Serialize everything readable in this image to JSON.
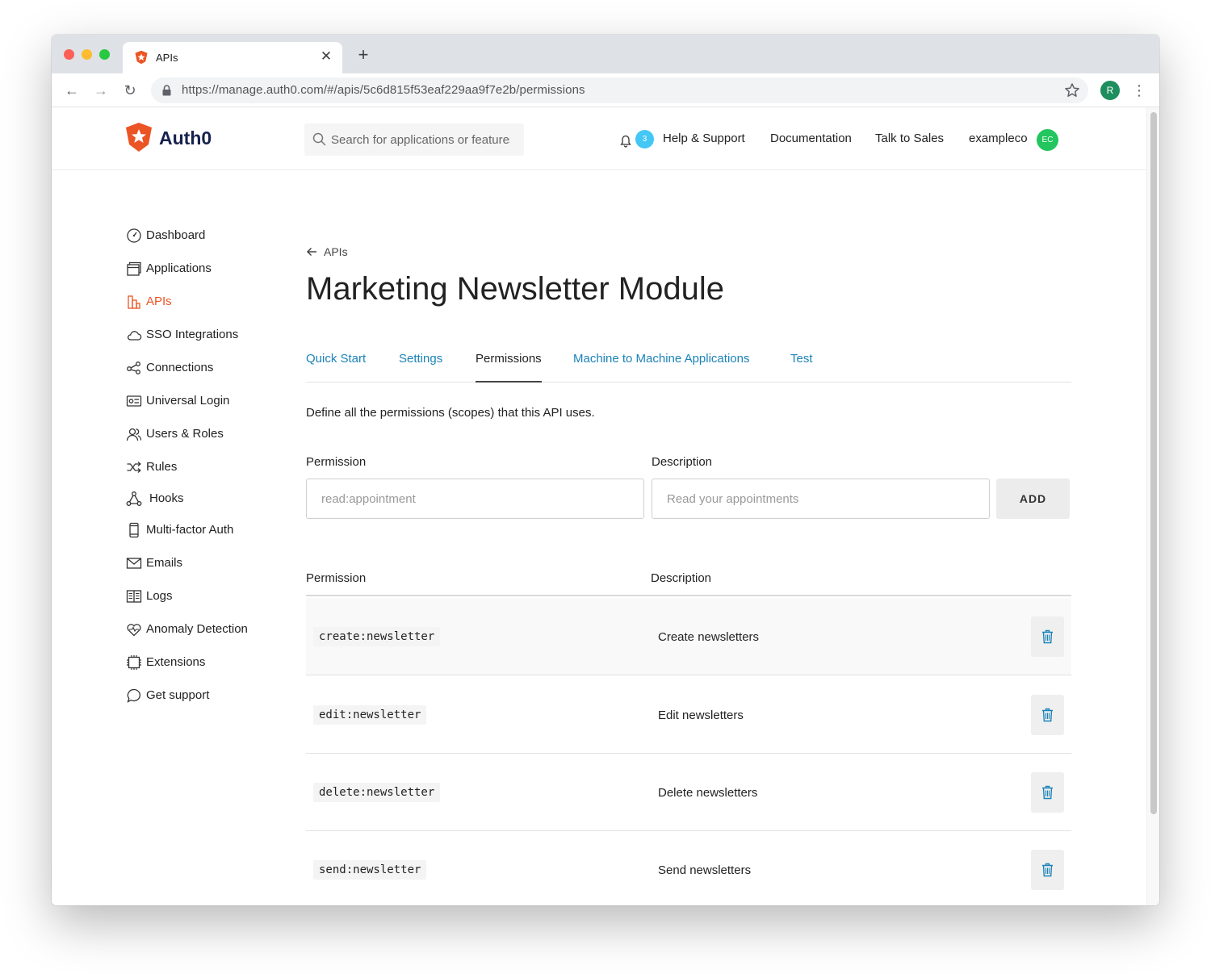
{
  "browser": {
    "tab_title": "APIs",
    "url": "https://manage.auth0.com/#/apis/5c6d815f53eaf229aa9f7e2b/permissions",
    "profile_initial": "R"
  },
  "header": {
    "logo_text": "Auth0",
    "search_placeholder": "Search for applications or features",
    "notification_count": "3",
    "links": [
      "Help & Support",
      "Documentation",
      "Talk to Sales"
    ],
    "tenant_name": "exampleco",
    "tenant_initials": "EC"
  },
  "sidebar": {
    "items": [
      {
        "label": "Dashboard",
        "icon": "gauge-icon"
      },
      {
        "label": "Applications",
        "icon": "applications-icon"
      },
      {
        "label": "APIs",
        "icon": "api-icon",
        "active": true
      },
      {
        "label": "SSO Integrations",
        "icon": "cloud-icon"
      },
      {
        "label": "Connections",
        "icon": "connections-icon"
      },
      {
        "label": "Universal Login",
        "icon": "login-icon"
      },
      {
        "label": "Users & Roles",
        "icon": "users-icon"
      },
      {
        "label": "Rules",
        "icon": "shuffle-icon"
      },
      {
        "label": "Hooks",
        "icon": "hooks-icon"
      },
      {
        "label": "Multi-factor Auth",
        "icon": "phone-icon"
      },
      {
        "label": "Emails",
        "icon": "mail-icon"
      },
      {
        "label": "Logs",
        "icon": "book-icon"
      },
      {
        "label": "Anomaly Detection",
        "icon": "heart-pulse-icon"
      },
      {
        "label": "Extensions",
        "icon": "chip-icon"
      },
      {
        "label": "Get support",
        "icon": "chat-bubble-icon"
      }
    ]
  },
  "main": {
    "back_label": "APIs",
    "title": "Marketing Newsletter Module",
    "tabs": [
      {
        "label": "Quick Start"
      },
      {
        "label": "Settings"
      },
      {
        "label": "Permissions",
        "active": true
      },
      {
        "label": "Machine to Machine Applications"
      },
      {
        "label": "Test"
      }
    ],
    "intro": "Define all the permissions (scopes) that this API uses.",
    "form": {
      "permission_label": "Permission",
      "permission_placeholder": "read:appointment",
      "description_label": "Description",
      "description_placeholder": "Read your appointments",
      "add_label": "ADD"
    },
    "table": {
      "headers": [
        "Permission",
        "Description"
      ],
      "rows": [
        {
          "permission": "create:newsletter",
          "description": "Create newsletters"
        },
        {
          "permission": "edit:newsletter",
          "description": "Edit newsletters"
        },
        {
          "permission": "delete:newsletter",
          "description": "Delete newsletters"
        },
        {
          "permission": "send:newsletter",
          "description": "Send newsletters"
        }
      ]
    }
  },
  "colors": {
    "brand": "#eb5424",
    "link": "#1c83b8",
    "badge": "#44c7f4",
    "tenant_avatar": "#22c55e",
    "trash": "#1c83b8"
  }
}
